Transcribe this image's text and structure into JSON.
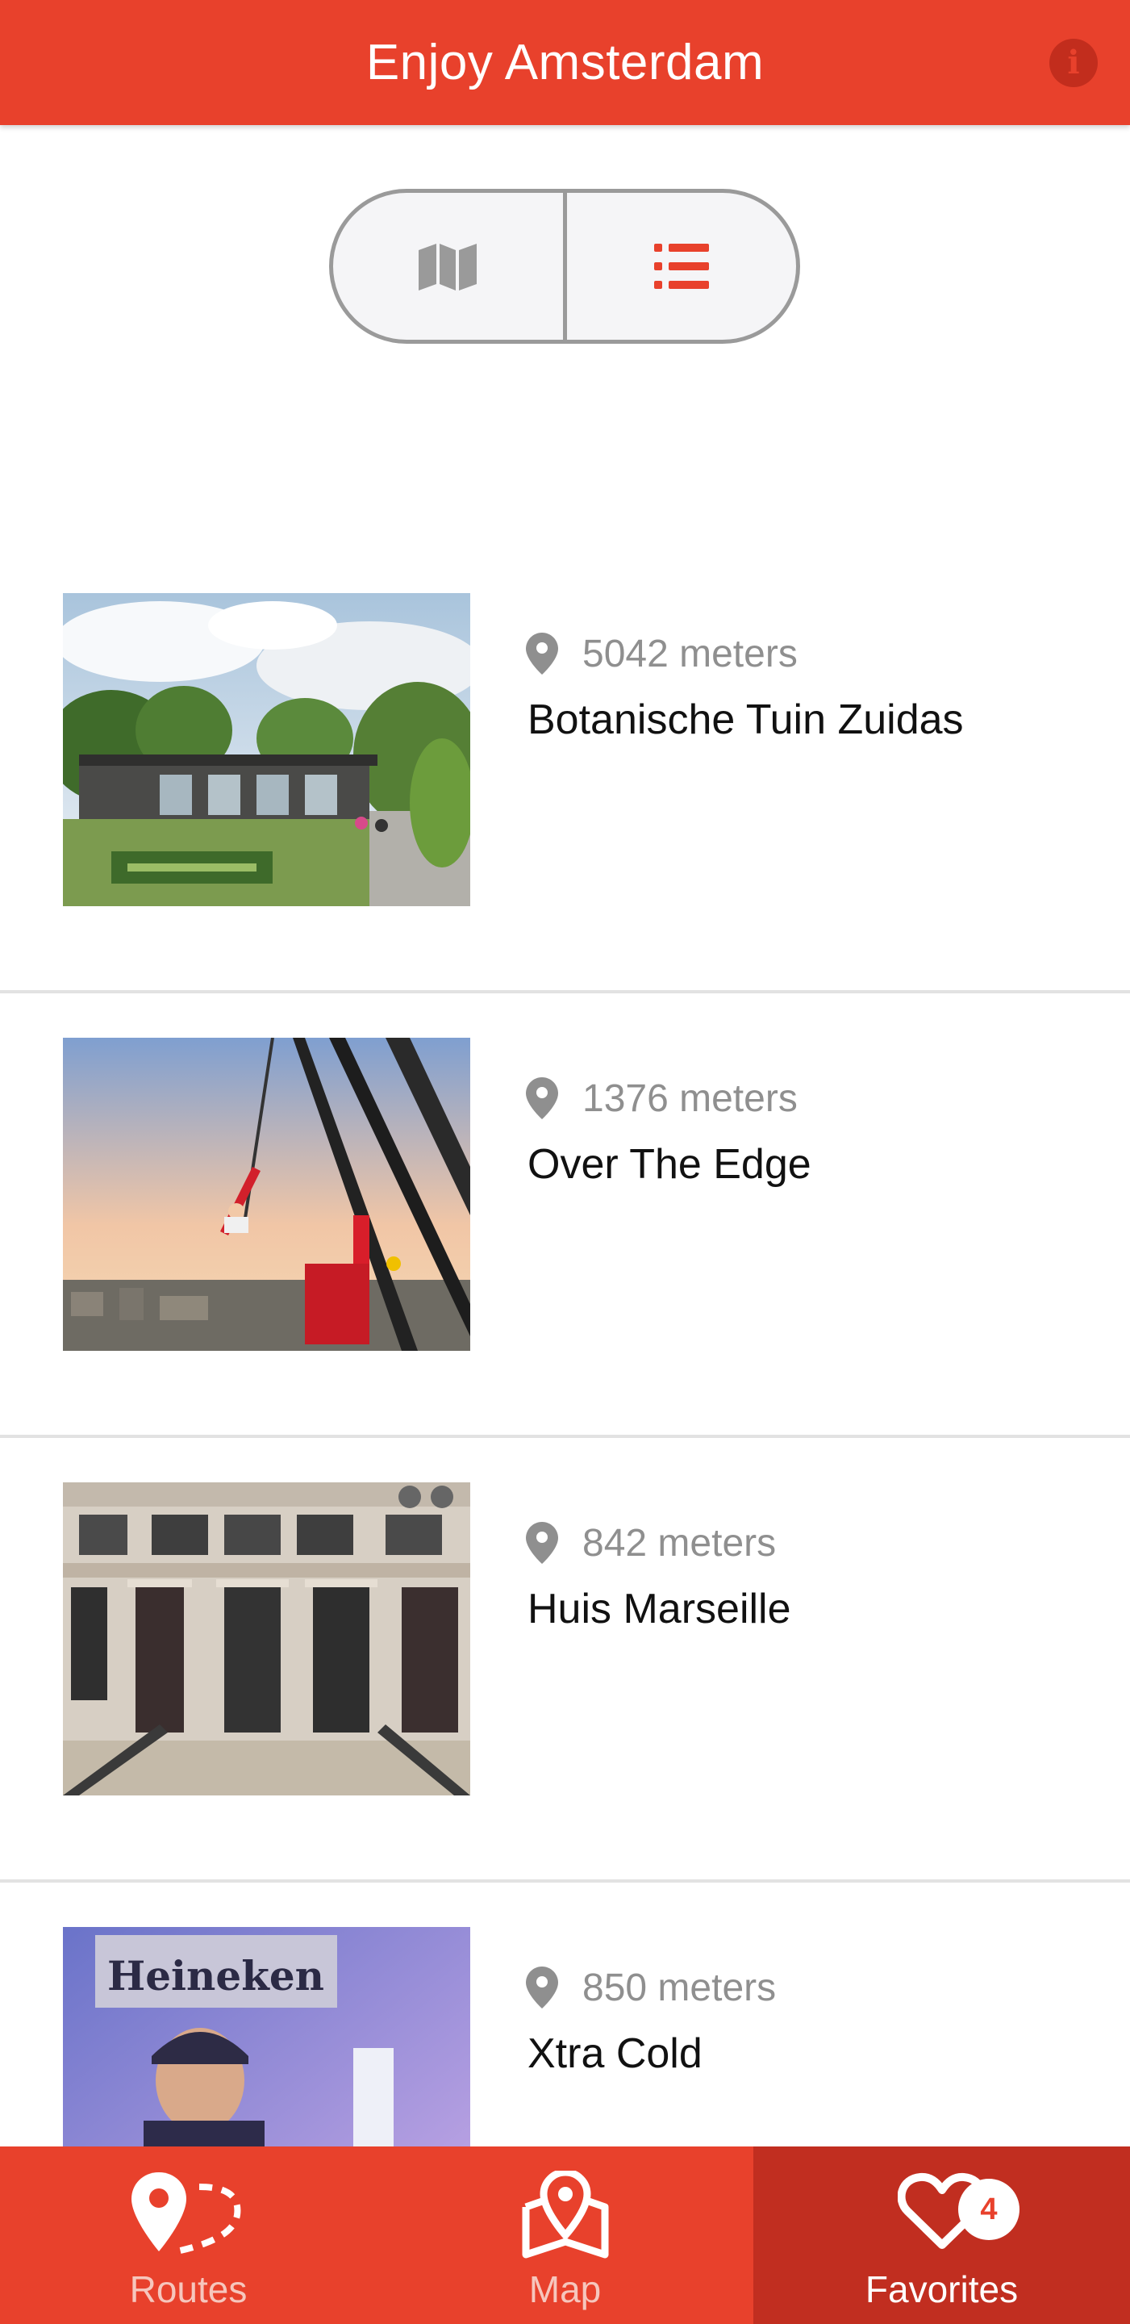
{
  "header": {
    "title": "Enjoy Amsterdam",
    "info_icon": "info-icon",
    "info_glyph": "i",
    "color": "#e8412c"
  },
  "view_toggle": {
    "options": [
      {
        "name": "map-view",
        "icon": "map-icon",
        "active": false
      },
      {
        "name": "list-view",
        "icon": "list-icon",
        "active": true
      }
    ]
  },
  "places": [
    {
      "distance": "5042 meters",
      "name": "Botanische Tuin Zuidas",
      "image": "garden-photo"
    },
    {
      "distance": "1376 meters",
      "name": "Over The Edge",
      "image": "swing-photo"
    },
    {
      "distance": "842 meters",
      "name": "Huis Marseille",
      "image": "building-photo"
    },
    {
      "distance": "850 meters",
      "name": "Xtra Cold",
      "image": "heineken-photo",
      "image_text": "Heineken"
    }
  ],
  "bottom_nav": {
    "items": [
      {
        "label": "Routes",
        "icon": "routes-icon",
        "active": false
      },
      {
        "label": "Map",
        "icon": "map-pin-icon",
        "active": false
      },
      {
        "label": "Favorites",
        "icon": "heart-icon",
        "active": true
      }
    ],
    "favorites_count": "4"
  },
  "colors": {
    "accent": "#e8412c",
    "accent_dark": "#c12e20",
    "muted_text": "#8f8f8f"
  }
}
